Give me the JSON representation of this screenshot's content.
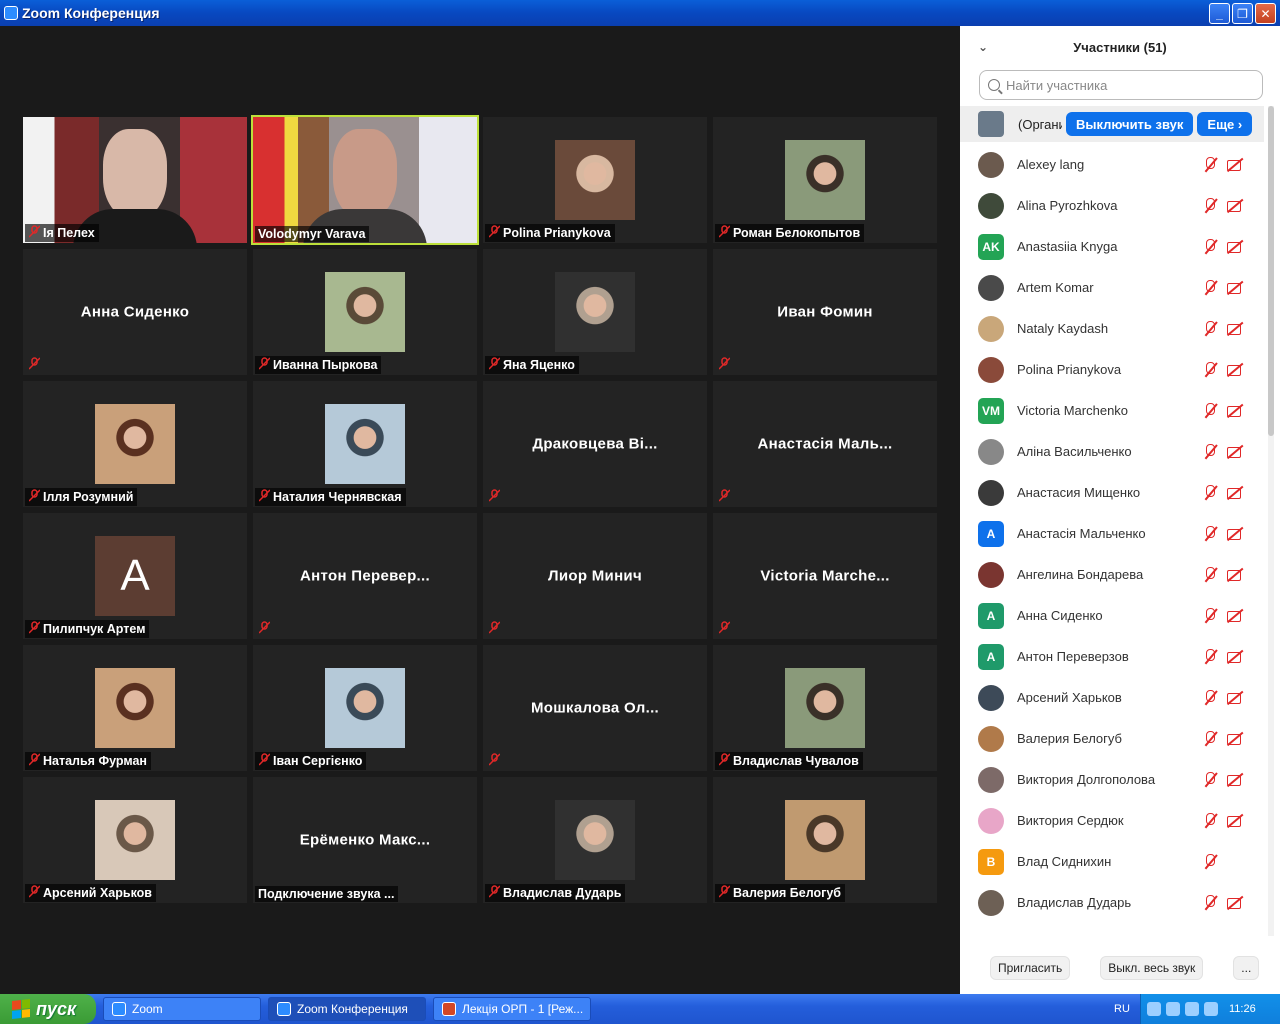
{
  "window": {
    "title": "Zoom Конференция",
    "minimize": "_",
    "maximize": "❐",
    "close": "✕"
  },
  "gallery": [
    {
      "name": "Ія Пелех",
      "center": "",
      "type": "video",
      "muted": true,
      "active": false
    },
    {
      "name": "Volodymyr Varava",
      "center": "",
      "type": "video",
      "muted": false,
      "active": true
    },
    {
      "name": "Polina Prianykova",
      "center": "",
      "type": "photo",
      "muted": true,
      "active": false
    },
    {
      "name": "Роман Белокопытов",
      "center": "",
      "type": "photo",
      "muted": true,
      "active": false
    },
    {
      "name": "",
      "center": "Анна Сиденко",
      "type": "name",
      "muted": true,
      "active": false
    },
    {
      "name": "Иванна Пыркова",
      "center": "",
      "type": "photo",
      "muted": true,
      "active": false
    },
    {
      "name": "Яна Яценко",
      "center": "",
      "type": "photo",
      "muted": true,
      "active": false
    },
    {
      "name": "",
      "center": "Иван Фомин",
      "type": "name",
      "muted": true,
      "active": false
    },
    {
      "name": "Ілля Розумний",
      "center": "",
      "type": "photo",
      "muted": true,
      "active": false
    },
    {
      "name": "Наталия Чернявская",
      "center": "",
      "type": "photo",
      "muted": true,
      "active": false
    },
    {
      "name": "",
      "center": "Драковцева Ві...",
      "type": "name",
      "muted": true,
      "active": false
    },
    {
      "name": "",
      "center": "Анастасія Маль...",
      "type": "name",
      "muted": true,
      "active": false
    },
    {
      "name": "Пилипчук Артем",
      "center": "A",
      "type": "letter",
      "muted": true,
      "active": false
    },
    {
      "name": "",
      "center": "Антон Перевер...",
      "type": "name",
      "muted": true,
      "active": false
    },
    {
      "name": "",
      "center": "Лиор Минич",
      "type": "name",
      "muted": true,
      "active": false
    },
    {
      "name": "",
      "center": "Victoria Marche...",
      "type": "name",
      "muted": true,
      "active": false
    },
    {
      "name": "Наталья Фурман",
      "center": "",
      "type": "photo",
      "muted": true,
      "active": false
    },
    {
      "name": "Іван Сергієнко",
      "center": "",
      "type": "photo",
      "muted": true,
      "active": false
    },
    {
      "name": "",
      "center": "Мошкалова Ол...",
      "type": "name",
      "muted": true,
      "active": false
    },
    {
      "name": "Владислав Чувалов",
      "center": "",
      "type": "photo",
      "muted": true,
      "active": false
    },
    {
      "name": "Арсений Харьков",
      "center": "",
      "type": "photo",
      "muted": true,
      "active": false
    },
    {
      "name": "Подключение звука ...",
      "center": "Ерёменко Макс...",
      "type": "name",
      "muted": false,
      "active": false
    },
    {
      "name": "Владислав Дударь",
      "center": "",
      "type": "photo",
      "muted": true,
      "active": false
    },
    {
      "name": "Валерия Белогуб",
      "center": "",
      "type": "photo",
      "muted": true,
      "active": false
    }
  ],
  "panel": {
    "title": "Участники (51)",
    "search_placeholder": "Найти участника",
    "host_name": "(Организатор)",
    "mute_button": "Выключить звук",
    "more_button": "Еще ›",
    "participants": [
      {
        "name": "Alexey lang",
        "initials": "",
        "color": "#6b5a4e",
        "cam": true
      },
      {
        "name": "Alina Pyrozhkova",
        "initials": "",
        "color": "#3f4a3a",
        "cam": true
      },
      {
        "name": "Anastasiia Knyga",
        "initials": "AK",
        "color": "#23a455",
        "cam": true
      },
      {
        "name": "Artem Komar",
        "initials": "",
        "color": "#4a4a4a",
        "cam": true
      },
      {
        "name": "Nataly Kaydash",
        "initials": "",
        "color": "#c9a77a",
        "cam": true
      },
      {
        "name": "Polina Prianykova",
        "initials": "",
        "color": "#8a4a3a",
        "cam": true
      },
      {
        "name": "Victoria Marchenko",
        "initials": "VM",
        "color": "#23a455",
        "cam": true
      },
      {
        "name": "Аліна Васильченко",
        "initials": "",
        "color": "#888888",
        "cam": true
      },
      {
        "name": "Анастасия Мищенко",
        "initials": "",
        "color": "#3a3a3a",
        "cam": true
      },
      {
        "name": "Анастасія Мальченко",
        "initials": "A",
        "color": "#0e71eb",
        "cam": true
      },
      {
        "name": "Ангелина Бондарева",
        "initials": "",
        "color": "#7a3530",
        "cam": true
      },
      {
        "name": "Анна Сиденко",
        "initials": "A",
        "color": "#1f9a6a",
        "cam": true
      },
      {
        "name": "Антон Переверзов",
        "initials": "A",
        "color": "#1f9a6a",
        "cam": true
      },
      {
        "name": "Арсений Харьков",
        "initials": "",
        "color": "#3d4a58",
        "cam": true
      },
      {
        "name": "Валерия Белогуб",
        "initials": "",
        "color": "#b07a4a",
        "cam": true
      },
      {
        "name": "Виктория Долгополова",
        "initials": "",
        "color": "#7d6a68",
        "cam": true
      },
      {
        "name": "Виктория Сердюк",
        "initials": "",
        "color": "#e8a6c8",
        "cam": true
      },
      {
        "name": "Влад Сидниxин",
        "initials": "B",
        "color": "#f59a0f",
        "cam": false
      },
      {
        "name": "Владислав Дударь",
        "initials": "",
        "color": "#6d6055",
        "cam": true
      }
    ],
    "invite_button": "Пригласить",
    "mute_all_button": "Выкл. весь звук",
    "more_dots": "..."
  },
  "taskbar": {
    "start_label": "пуск",
    "tasks": [
      {
        "label": "Zoom",
        "icon": "zoom-icon",
        "pressed": false
      },
      {
        "label": "Zoom Конференция",
        "icon": "zoom-icon",
        "pressed": true
      },
      {
        "label": "Лекція ОРП - 1 [Реж...",
        "icon": "powerpoint-icon",
        "pressed": false
      }
    ],
    "lang": "RU",
    "clock": "11:26"
  }
}
